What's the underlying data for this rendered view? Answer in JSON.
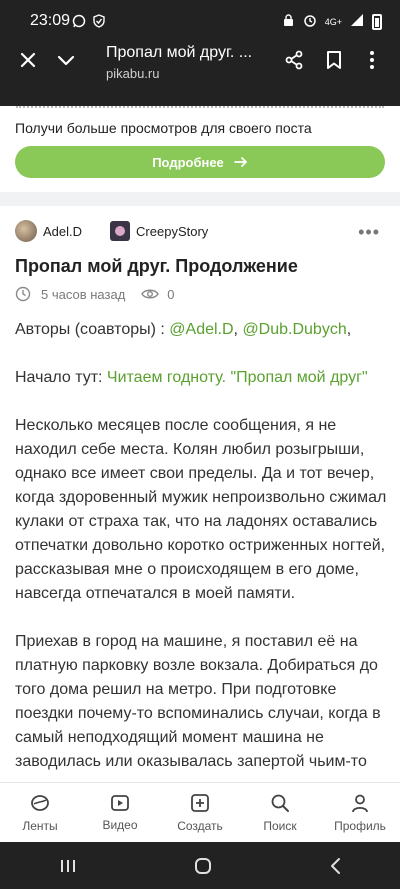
{
  "status": {
    "time": "23:09",
    "network": "4G+"
  },
  "header": {
    "title": "Пропал мой друг. ...",
    "subtitle": "pikabu.ru"
  },
  "promo": {
    "text": "Получи больше просмотров для своего поста",
    "cta": "Подробнее"
  },
  "post": {
    "author": "Adel.D",
    "community": "CreepyStory",
    "title": "Пропал мой друг. Продолжение",
    "time_ago": "5 часов назад",
    "views": "0",
    "authors_prefix": "Авторы (соавторы) : ",
    "author_link_1": "@Adel.D",
    "authors_sep": ", ",
    "author_link_2": "@Dub.Dubych",
    "authors_suffix": ",",
    "start_prefix": "Начало тут: ",
    "start_link": "Читаем годноту. \"Пропал мой друг\"",
    "paragraph_1": "Несколько месяцев после сообщения, я не находил себе места. Колян любил розыгрыши, однако все имеет свои пределы. Да и тот вечер, когда здоровенный мужик непроизвольно сжимал кулаки от страха так, что на ладонях оставались отпечатки довольно коротко остриженных ногтей, рассказывая мне о происходящем в его доме, навсегда отпечатался в моей памяти.",
    "paragraph_2": "Приехав в город на машине, я поставил её на платную парковку возле вокзала. Добираться до того дома решил на метро. При подготовке поездки почему-то вспоминались случаи, когда в самый неподходящий момент машина не заводилась или оказывалась запертой чьим-то"
  },
  "bottom_nav": {
    "feeds": "Ленты",
    "video": "Видео",
    "create": "Создать",
    "search": "Поиск",
    "profile": "Профиль"
  },
  "colors": {
    "header_bg": "#222222",
    "accent_green": "#8ac858",
    "link_green": "#5aa12f"
  }
}
